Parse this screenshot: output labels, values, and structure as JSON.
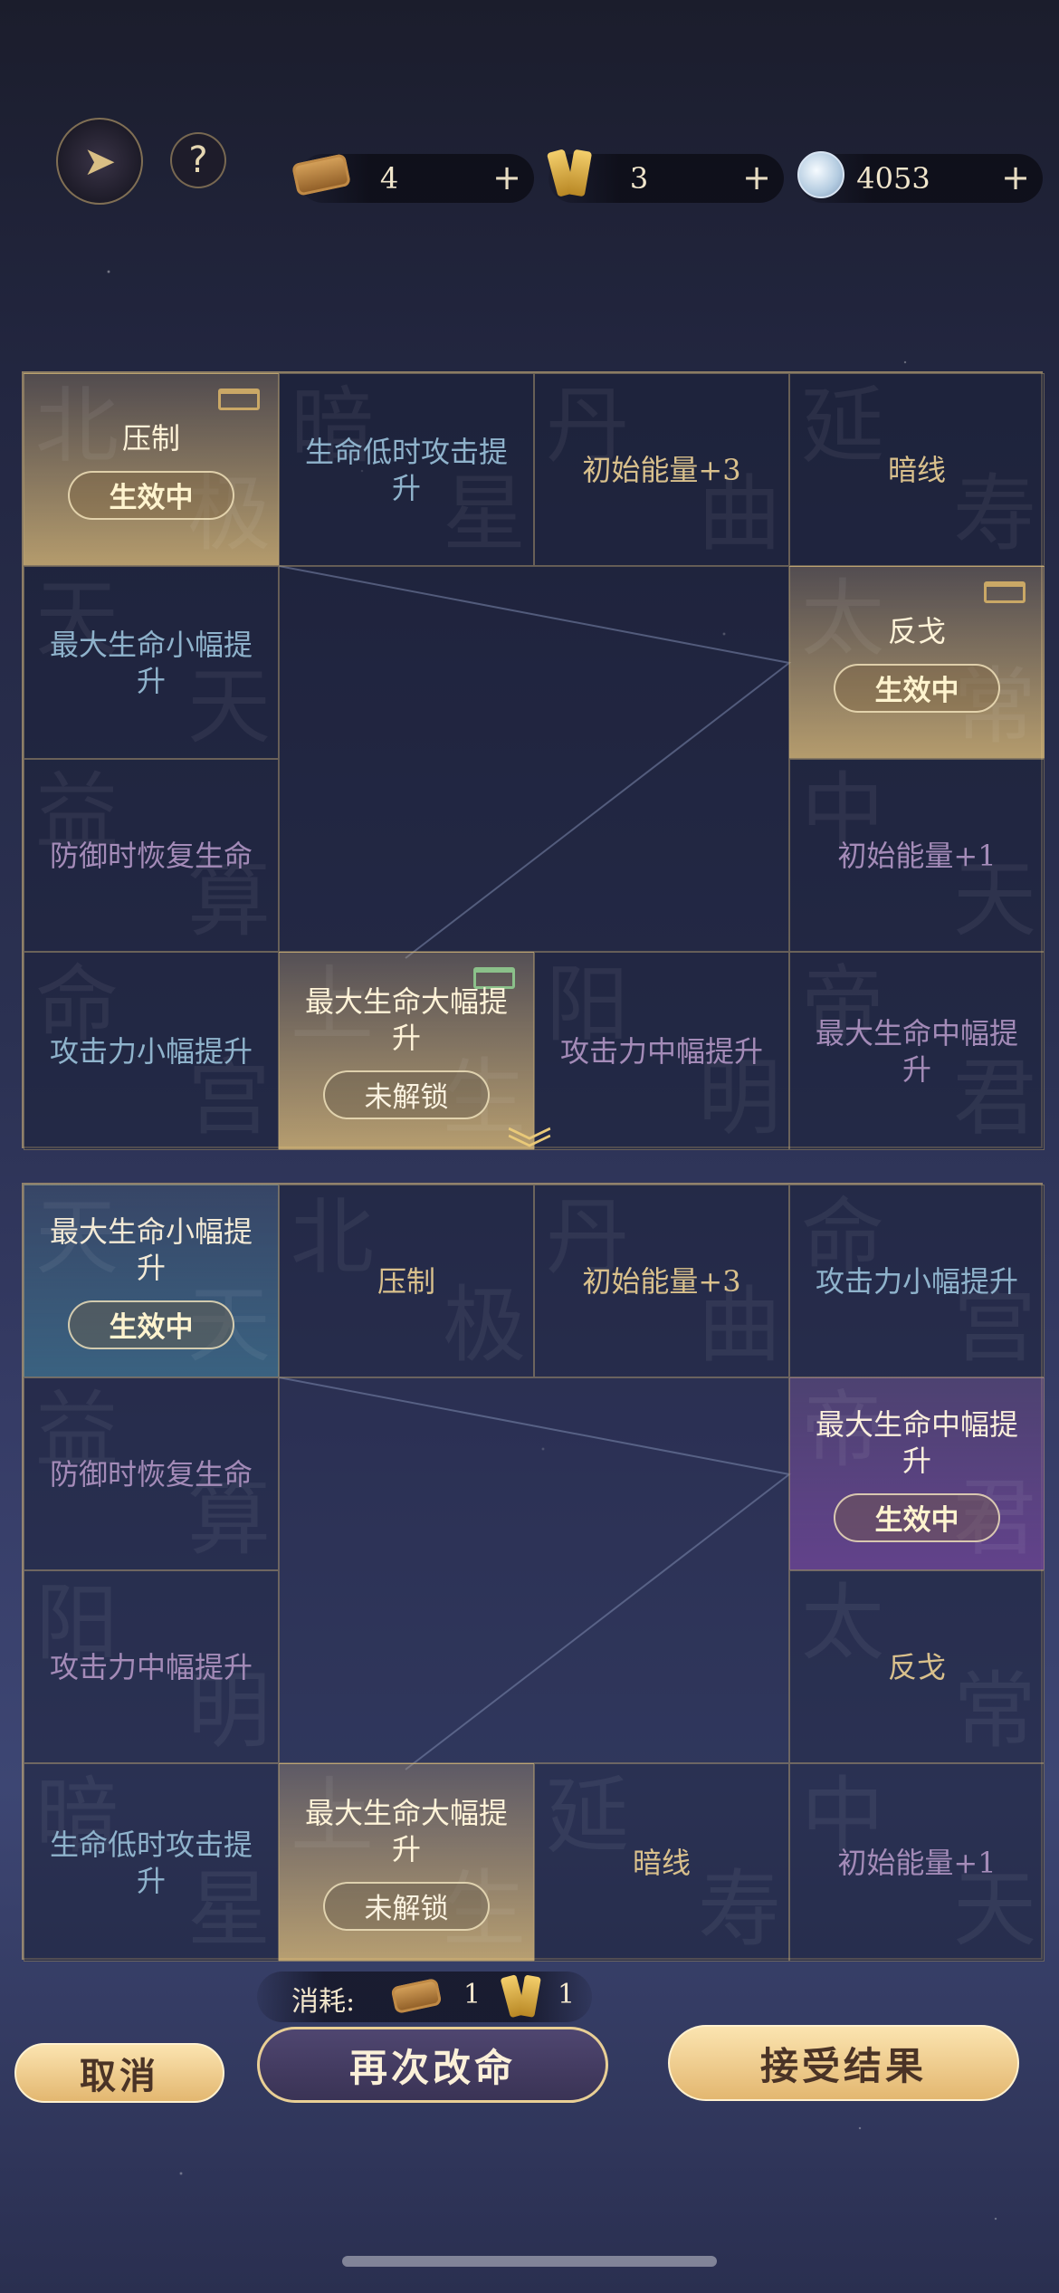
{
  "resources": [
    {
      "icon": "scroll-icon",
      "value": "4",
      "plus": "+"
    },
    {
      "icon": "talisman-icon",
      "value": "3",
      "plus": "+"
    },
    {
      "icon": "spirit-orb-icon",
      "value": "4053",
      "plus": "+"
    }
  ],
  "help_label": "?",
  "grid_top": {
    "cells": [
      {
        "label": "压制",
        "state": "生效中",
        "bg": [
          "北",
          "极"
        ]
      },
      {
        "label": "生命低时攻击提升",
        "bg": [
          "暗",
          "星"
        ]
      },
      {
        "label": "初始能量+3",
        "bg": [
          "丹",
          "曲"
        ]
      },
      {
        "label": "暗线",
        "bg": [
          "延",
          "寿"
        ]
      },
      {
        "label": "最大生命小幅提升",
        "bg": [
          "天",
          "天"
        ]
      },
      {
        "label": "反戈",
        "state": "生效中",
        "bg": [
          "太",
          "常"
        ]
      },
      {
        "label": "防御时恢复生命",
        "bg": [
          "益",
          "算"
        ]
      },
      {
        "label": "初始能量+1",
        "bg": [
          "中",
          "天"
        ]
      },
      {
        "label": "攻击力小幅提升",
        "bg": [
          "命",
          "宫"
        ]
      },
      {
        "label": "最大生命大幅提升",
        "state": "未解锁",
        "bg": [
          "上",
          "生"
        ]
      },
      {
        "label": "攻击力中幅提升",
        "bg": [
          "阳",
          "明"
        ]
      },
      {
        "label": "最大生命中幅提升",
        "bg": [
          "帝",
          "君"
        ]
      }
    ]
  },
  "grid_bottom": {
    "cells": [
      {
        "label": "最大生命小幅提升",
        "state": "生效中",
        "bg": [
          "天",
          "天"
        ]
      },
      {
        "label": "压制",
        "bg": [
          "北",
          "极"
        ]
      },
      {
        "label": "初始能量+3",
        "bg": [
          "丹",
          "曲"
        ]
      },
      {
        "label": "攻击力小幅提升",
        "bg": [
          "命",
          "宫"
        ]
      },
      {
        "label": "防御时恢复生命",
        "bg": [
          "益",
          "算"
        ]
      },
      {
        "label": "最大生命中幅提升",
        "state": "生效中",
        "bg": [
          "帝",
          "君"
        ]
      },
      {
        "label": "攻击力中幅提升",
        "bg": [
          "阳",
          "明"
        ]
      },
      {
        "label": "反戈",
        "bg": [
          "太",
          "常"
        ]
      },
      {
        "label": "生命低时攻击提升",
        "bg": [
          "暗",
          "星"
        ]
      },
      {
        "label": "最大生命大幅提升",
        "state": "未解锁",
        "bg": [
          "上",
          "生"
        ]
      },
      {
        "label": "暗线",
        "bg": [
          "延",
          "寿"
        ]
      },
      {
        "label": "初始能量+1",
        "bg": [
          "中",
          "天"
        ]
      }
    ]
  },
  "cost": {
    "label": "消耗:",
    "scroll_count": "1",
    "talisman_count": "1"
  },
  "buttons": {
    "cancel": "取消",
    "retry": "再次改命",
    "accept": "接受结果"
  },
  "colors": {
    "gold_text": "#d9c08c",
    "blue_text": "#8fb3cc",
    "purple_text": "#a48bb8",
    "accent_gold": "#e9cf95"
  }
}
